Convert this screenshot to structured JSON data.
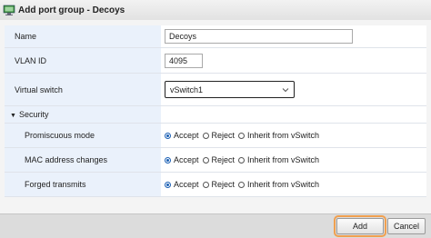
{
  "dialog": {
    "title": "Add port group - Decoys"
  },
  "fields": {
    "name_label": "Name",
    "name_value": "Decoys",
    "vlan_label": "VLAN ID",
    "vlan_value": "4095",
    "vswitch_label": "Virtual switch",
    "vswitch_value": "vSwitch1"
  },
  "security": {
    "label": "Security",
    "rows": [
      {
        "label": "Promiscuous mode",
        "selected": "Accept"
      },
      {
        "label": "MAC address changes",
        "selected": "Accept"
      },
      {
        "label": "Forged transmits",
        "selected": "Accept"
      }
    ],
    "options": [
      "Accept",
      "Reject",
      "Inherit from vSwitch"
    ]
  },
  "footer": {
    "add_label": "Add",
    "cancel_label": "Cancel"
  },
  "colors": {
    "accent": "#1a5fb4",
    "label_bg": "#eaf1fb",
    "focus_outline": "#f0a050"
  }
}
